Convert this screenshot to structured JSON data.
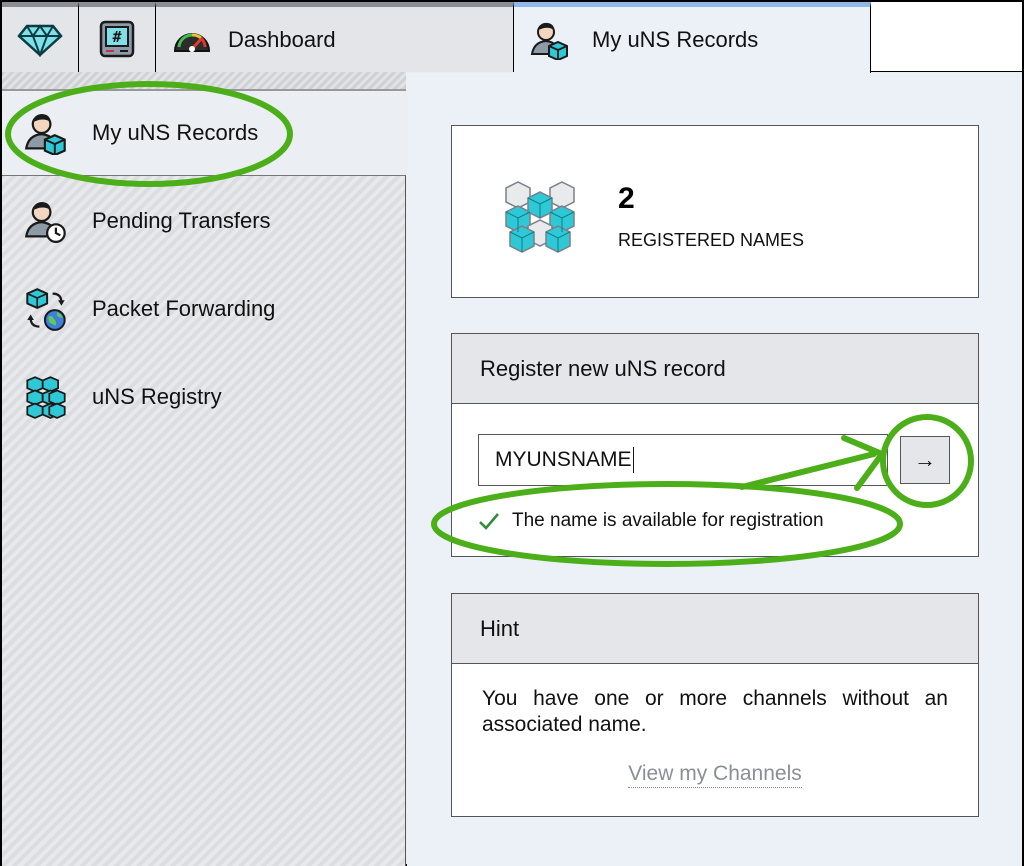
{
  "tabs": [
    {
      "icon": "diamond-icon",
      "label": ""
    },
    {
      "icon": "terminal-icon",
      "label": ""
    },
    {
      "icon": "speedometer-icon",
      "label": "Dashboard"
    },
    {
      "icon": "user-cube-icon",
      "label": "My uNS Records",
      "active": true
    }
  ],
  "sidebar": {
    "items": [
      {
        "icon": "user-cube-icon",
        "label": "My uNS Records",
        "active": true
      },
      {
        "icon": "user-clock-icon",
        "label": "Pending Transfers"
      },
      {
        "icon": "cube-globe-icon",
        "label": "Packet Forwarding"
      },
      {
        "icon": "cubes-grid-icon",
        "label": "uNS Registry"
      }
    ]
  },
  "stats": {
    "count": "2",
    "label": "REGISTERED NAMES"
  },
  "register": {
    "title": "Register new uNS record",
    "input_value": "MYUNSNAME",
    "button_symbol": "→",
    "status": "The name is available for registration"
  },
  "hint": {
    "title": "Hint",
    "text": "You have one or more channels without an associated name.",
    "link": "View my Channels"
  },
  "colors": {
    "accent_cube": "#2ec8d6",
    "annotation_green": "#4caf1a",
    "active_tab_stripe": "#8fb8e8",
    "link_gray": "#8a8f96"
  }
}
